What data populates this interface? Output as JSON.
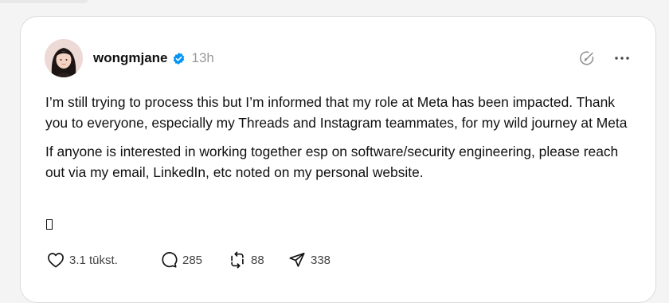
{
  "post": {
    "username": "wongmjane",
    "time": "13h",
    "paragraph1": "I’m still trying to process this but I’m informed that my role at Meta has been impacted. Thank you to everyone, especially my Threads and Instagram teammates, for my wild journey at Meta",
    "paragraph2": "If anyone is interested in working together esp on software/security engineering, please reach out via my email, LinkedIn, etc noted on my personal website."
  },
  "actions": {
    "likes": "3.1 tūkst.",
    "replies": "285",
    "reposts": "88",
    "shares": "338"
  },
  "icons": {
    "verified": "verified-badge-icon",
    "header_action": "pen-circle-icon",
    "more": "more-icon",
    "like": "heart-icon",
    "reply": "comment-icon",
    "repost": "repost-icon",
    "share": "send-icon"
  },
  "colors": {
    "verified": "#0095f6",
    "text": "#101010",
    "muted": "#999999"
  }
}
